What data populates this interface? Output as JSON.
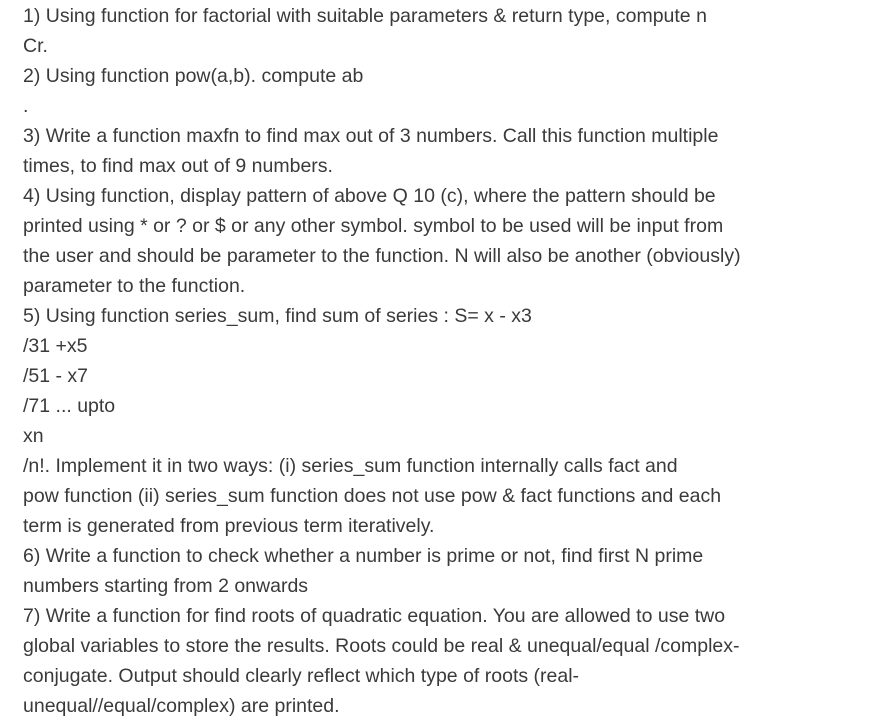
{
  "document": {
    "lines": [
      "1) Using function for factorial with suitable parameters & return type, compute n",
      "Cr.",
      "2) Using function pow(a,b). compute ab",
      ".",
      "3) Write a function maxfn to find max out of 3 numbers. Call this function multiple",
      "times, to find max out of 9 numbers.",
      "4) Using function, display pattern of above Q 10 (c), where the pattern should be",
      "printed using * or ? or $ or any other symbol. symbol to be used will be input from",
      "the user and should be parameter to the function. N will also be another (obviously)",
      "parameter to the function.",
      "5) Using function series_sum, find sum of series : S= x - x3",
      "/31 +x5",
      "/51 - x7",
      "/71 ... upto",
      "xn",
      "/n!. Implement it in two ways: (i) series_sum function internally calls fact and",
      "pow function (ii) series_sum function does not use pow & fact functions and each",
      "term is generated from previous term iteratively.",
      "6) Write a function to check whether a number is prime or not, find first N prime",
      "numbers starting from 2 onwards",
      "7) Write a function for find roots of quadratic equation. You are allowed to use two",
      "global variables to store the results. Roots could be real & unequal/equal /complex-",
      "conjugate. Output should clearly reflect which type of roots (real-",
      "unequal//equal/complex) are printed."
    ]
  }
}
